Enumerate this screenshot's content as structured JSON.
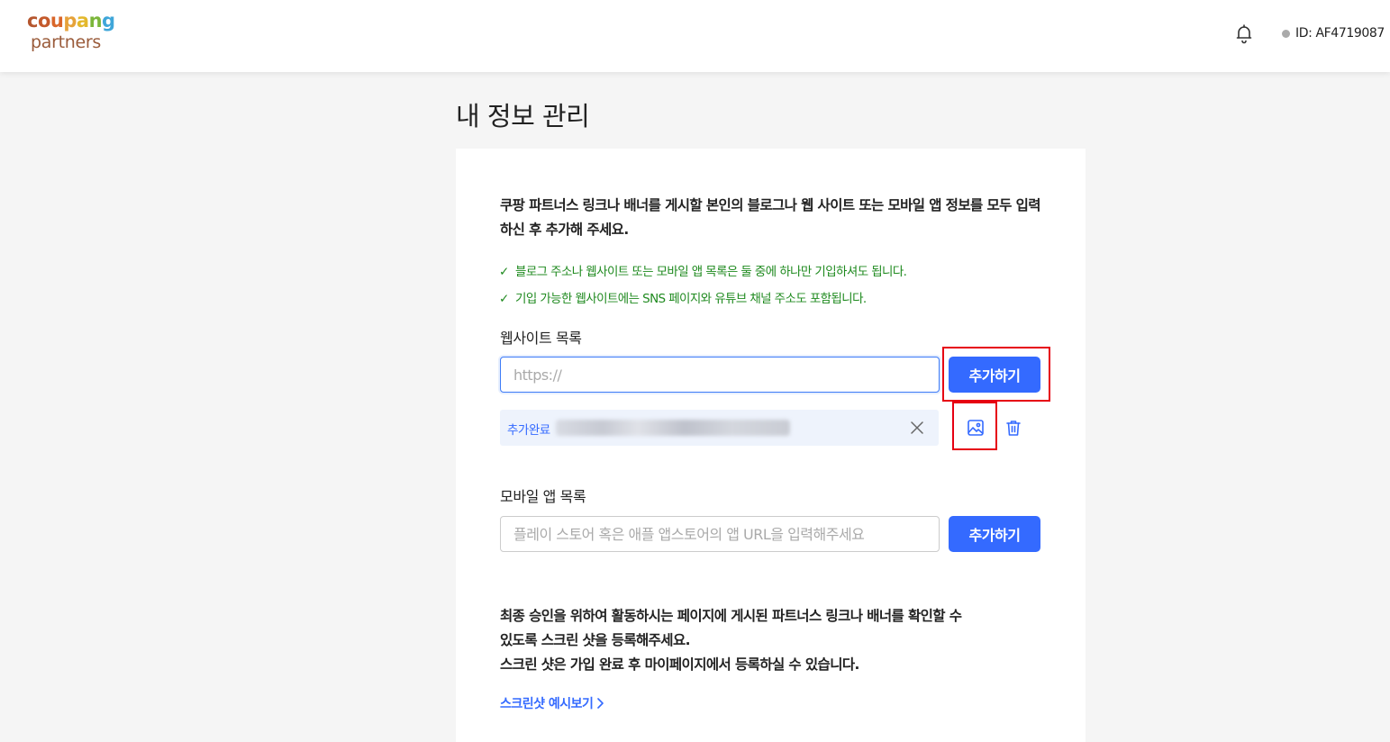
{
  "header": {
    "logo_line1": "coupang",
    "logo_line2": "partners",
    "user_id": "ID: AF4719087",
    "icons": {
      "bell": "bell-icon"
    },
    "logo_colors": [
      "#b5562e",
      "#e6a23a",
      "#7bb63a",
      "#3fa6d9"
    ]
  },
  "page": {
    "title": "내 정보 관리"
  },
  "intro": {
    "text": "쿠팡 파트너스 링크나 배너를 게시할 본인의 블로그나 웹 사이트 또는 모바일 앱 정보를 모두 입력하신 후 추가해 주세요."
  },
  "notes": [
    {
      "check": "✓",
      "text": "블로그 주소나 웹사이트 또는 모바일 앱 목록은 둘 중에 하나만 기입하셔도 됩니다."
    },
    {
      "check": "✓",
      "text": "기입 가능한 웹사이트에는 SNS 페이지와 유튜브 채널 주소도 포함됩니다."
    }
  ],
  "website": {
    "label": "웹사이트 목록",
    "placeholder": "https://",
    "add_label": "추가하기",
    "added_label": "추가완료"
  },
  "mobile": {
    "label": "모바일 앱 목록",
    "placeholder": "플레이 스토어 혹은 애플 앱스토어의 앱 URL을 입력해주세요",
    "add_label": "추가하기"
  },
  "final": {
    "line1": "최종 승인을 위하여 활동하시는 페이지에 게시된 파트너스 링크나 배너를 확인할 수",
    "line2": "있도록 스크린 샷을 등록해주세요.",
    "line3": "스크린 샷은 가입 완료 후 마이페이지에서 등록하실 수 있습니다.",
    "link": "스크린샷 예시보기"
  },
  "colors": {
    "accent": "#346aff",
    "note_green": "#1f8a1f",
    "highlight_red": "#e60012"
  }
}
